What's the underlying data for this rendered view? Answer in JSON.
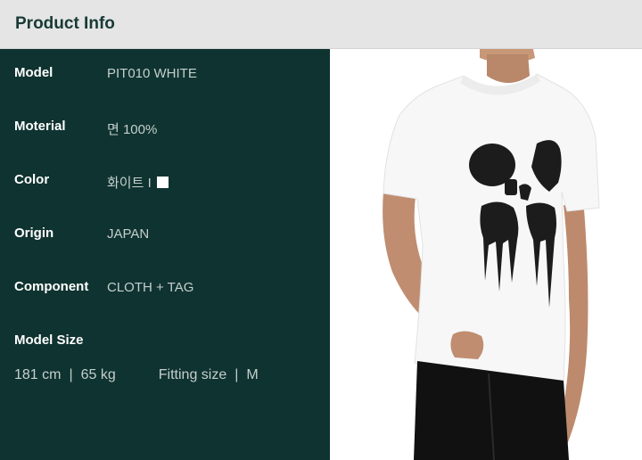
{
  "header": {
    "title": "Product Info"
  },
  "specs": {
    "model": {
      "label": "Model",
      "value": "PIT010 WHITE"
    },
    "material": {
      "label": "Moterial",
      "value": "면 100%"
    },
    "color": {
      "label": "Color",
      "value": "화이트 I",
      "swatch_color": "#ffffff"
    },
    "origin": {
      "label": "Origin",
      "value": "JAPAN"
    },
    "component": {
      "label": "Component",
      "value": "CLOTH + TAG"
    },
    "model_size": {
      "label": "Model Size"
    }
  },
  "model_info": {
    "height": "181 cm",
    "sep1": "|",
    "weight": "65 kg",
    "fitting_label": "Fitting size",
    "sep2": "|",
    "fitting_value": "M"
  },
  "photo": {
    "subject": "model wearing white t-shirt with dripping skull print"
  },
  "colors": {
    "panel_bg": "#0f3330",
    "header_bg": "#e5e5e5",
    "title": "#183a35"
  }
}
